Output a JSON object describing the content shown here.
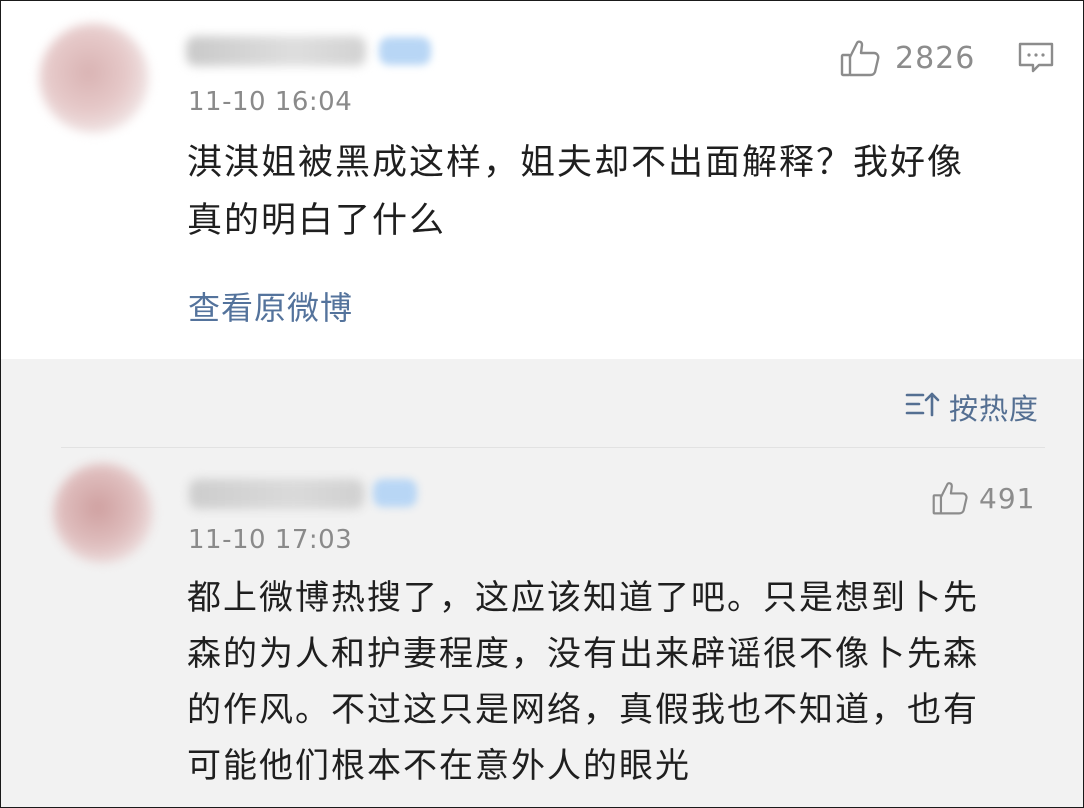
{
  "main_post": {
    "time": "11-10 16:04",
    "likes": "2826",
    "text_lines": [
      "淇淇姐被黑成这样，姐夫却不出面解释？我好像",
      "真的明白了什么"
    ],
    "view_original": "查看原微博"
  },
  "comments_header": {
    "sort_label": "按热度"
  },
  "comment": {
    "time": "11-10 17:03",
    "likes": "491",
    "text_lines": [
      "都上微博热搜了，这应该知道了吧。只是想到卜先",
      "森的为人和护妻程度，没有出来辟谣很不像卜先森",
      "的作风。不过这只是网络，真假我也不知道，也有",
      "可能他们根本不在意外人的眼光"
    ]
  },
  "colors": {
    "link": "#54739c",
    "text": "#1f1f1f",
    "meta": "#8a8a8a",
    "comment_bg": "#f2f2f2"
  },
  "icons": [
    "thumbs-up-icon",
    "comment-icon",
    "sort-icon"
  ]
}
